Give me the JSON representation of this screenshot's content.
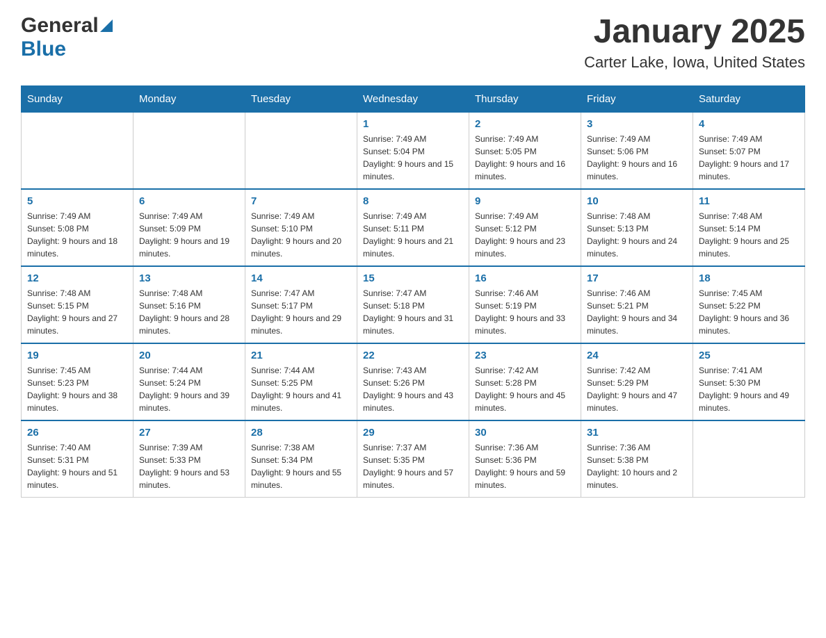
{
  "header": {
    "logo_general": "General",
    "logo_blue": "Blue",
    "title": "January 2025",
    "subtitle": "Carter Lake, Iowa, United States"
  },
  "days_of_week": [
    "Sunday",
    "Monday",
    "Tuesday",
    "Wednesday",
    "Thursday",
    "Friday",
    "Saturday"
  ],
  "weeks": [
    [
      {
        "day": "",
        "sunrise": "",
        "sunset": "",
        "daylight": ""
      },
      {
        "day": "",
        "sunrise": "",
        "sunset": "",
        "daylight": ""
      },
      {
        "day": "",
        "sunrise": "",
        "sunset": "",
        "daylight": ""
      },
      {
        "day": "1",
        "sunrise": "Sunrise: 7:49 AM",
        "sunset": "Sunset: 5:04 PM",
        "daylight": "Daylight: 9 hours and 15 minutes."
      },
      {
        "day": "2",
        "sunrise": "Sunrise: 7:49 AM",
        "sunset": "Sunset: 5:05 PM",
        "daylight": "Daylight: 9 hours and 16 minutes."
      },
      {
        "day": "3",
        "sunrise": "Sunrise: 7:49 AM",
        "sunset": "Sunset: 5:06 PM",
        "daylight": "Daylight: 9 hours and 16 minutes."
      },
      {
        "day": "4",
        "sunrise": "Sunrise: 7:49 AM",
        "sunset": "Sunset: 5:07 PM",
        "daylight": "Daylight: 9 hours and 17 minutes."
      }
    ],
    [
      {
        "day": "5",
        "sunrise": "Sunrise: 7:49 AM",
        "sunset": "Sunset: 5:08 PM",
        "daylight": "Daylight: 9 hours and 18 minutes."
      },
      {
        "day": "6",
        "sunrise": "Sunrise: 7:49 AM",
        "sunset": "Sunset: 5:09 PM",
        "daylight": "Daylight: 9 hours and 19 minutes."
      },
      {
        "day": "7",
        "sunrise": "Sunrise: 7:49 AM",
        "sunset": "Sunset: 5:10 PM",
        "daylight": "Daylight: 9 hours and 20 minutes."
      },
      {
        "day": "8",
        "sunrise": "Sunrise: 7:49 AM",
        "sunset": "Sunset: 5:11 PM",
        "daylight": "Daylight: 9 hours and 21 minutes."
      },
      {
        "day": "9",
        "sunrise": "Sunrise: 7:49 AM",
        "sunset": "Sunset: 5:12 PM",
        "daylight": "Daylight: 9 hours and 23 minutes."
      },
      {
        "day": "10",
        "sunrise": "Sunrise: 7:48 AM",
        "sunset": "Sunset: 5:13 PM",
        "daylight": "Daylight: 9 hours and 24 minutes."
      },
      {
        "day": "11",
        "sunrise": "Sunrise: 7:48 AM",
        "sunset": "Sunset: 5:14 PM",
        "daylight": "Daylight: 9 hours and 25 minutes."
      }
    ],
    [
      {
        "day": "12",
        "sunrise": "Sunrise: 7:48 AM",
        "sunset": "Sunset: 5:15 PM",
        "daylight": "Daylight: 9 hours and 27 minutes."
      },
      {
        "day": "13",
        "sunrise": "Sunrise: 7:48 AM",
        "sunset": "Sunset: 5:16 PM",
        "daylight": "Daylight: 9 hours and 28 minutes."
      },
      {
        "day": "14",
        "sunrise": "Sunrise: 7:47 AM",
        "sunset": "Sunset: 5:17 PM",
        "daylight": "Daylight: 9 hours and 29 minutes."
      },
      {
        "day": "15",
        "sunrise": "Sunrise: 7:47 AM",
        "sunset": "Sunset: 5:18 PM",
        "daylight": "Daylight: 9 hours and 31 minutes."
      },
      {
        "day": "16",
        "sunrise": "Sunrise: 7:46 AM",
        "sunset": "Sunset: 5:19 PM",
        "daylight": "Daylight: 9 hours and 33 minutes."
      },
      {
        "day": "17",
        "sunrise": "Sunrise: 7:46 AM",
        "sunset": "Sunset: 5:21 PM",
        "daylight": "Daylight: 9 hours and 34 minutes."
      },
      {
        "day": "18",
        "sunrise": "Sunrise: 7:45 AM",
        "sunset": "Sunset: 5:22 PM",
        "daylight": "Daylight: 9 hours and 36 minutes."
      }
    ],
    [
      {
        "day": "19",
        "sunrise": "Sunrise: 7:45 AM",
        "sunset": "Sunset: 5:23 PM",
        "daylight": "Daylight: 9 hours and 38 minutes."
      },
      {
        "day": "20",
        "sunrise": "Sunrise: 7:44 AM",
        "sunset": "Sunset: 5:24 PM",
        "daylight": "Daylight: 9 hours and 39 minutes."
      },
      {
        "day": "21",
        "sunrise": "Sunrise: 7:44 AM",
        "sunset": "Sunset: 5:25 PM",
        "daylight": "Daylight: 9 hours and 41 minutes."
      },
      {
        "day": "22",
        "sunrise": "Sunrise: 7:43 AM",
        "sunset": "Sunset: 5:26 PM",
        "daylight": "Daylight: 9 hours and 43 minutes."
      },
      {
        "day": "23",
        "sunrise": "Sunrise: 7:42 AM",
        "sunset": "Sunset: 5:28 PM",
        "daylight": "Daylight: 9 hours and 45 minutes."
      },
      {
        "day": "24",
        "sunrise": "Sunrise: 7:42 AM",
        "sunset": "Sunset: 5:29 PM",
        "daylight": "Daylight: 9 hours and 47 minutes."
      },
      {
        "day": "25",
        "sunrise": "Sunrise: 7:41 AM",
        "sunset": "Sunset: 5:30 PM",
        "daylight": "Daylight: 9 hours and 49 minutes."
      }
    ],
    [
      {
        "day": "26",
        "sunrise": "Sunrise: 7:40 AM",
        "sunset": "Sunset: 5:31 PM",
        "daylight": "Daylight: 9 hours and 51 minutes."
      },
      {
        "day": "27",
        "sunrise": "Sunrise: 7:39 AM",
        "sunset": "Sunset: 5:33 PM",
        "daylight": "Daylight: 9 hours and 53 minutes."
      },
      {
        "day": "28",
        "sunrise": "Sunrise: 7:38 AM",
        "sunset": "Sunset: 5:34 PM",
        "daylight": "Daylight: 9 hours and 55 minutes."
      },
      {
        "day": "29",
        "sunrise": "Sunrise: 7:37 AM",
        "sunset": "Sunset: 5:35 PM",
        "daylight": "Daylight: 9 hours and 57 minutes."
      },
      {
        "day": "30",
        "sunrise": "Sunrise: 7:36 AM",
        "sunset": "Sunset: 5:36 PM",
        "daylight": "Daylight: 9 hours and 59 minutes."
      },
      {
        "day": "31",
        "sunrise": "Sunrise: 7:36 AM",
        "sunset": "Sunset: 5:38 PM",
        "daylight": "Daylight: 10 hours and 2 minutes."
      },
      {
        "day": "",
        "sunrise": "",
        "sunset": "",
        "daylight": ""
      }
    ]
  ]
}
